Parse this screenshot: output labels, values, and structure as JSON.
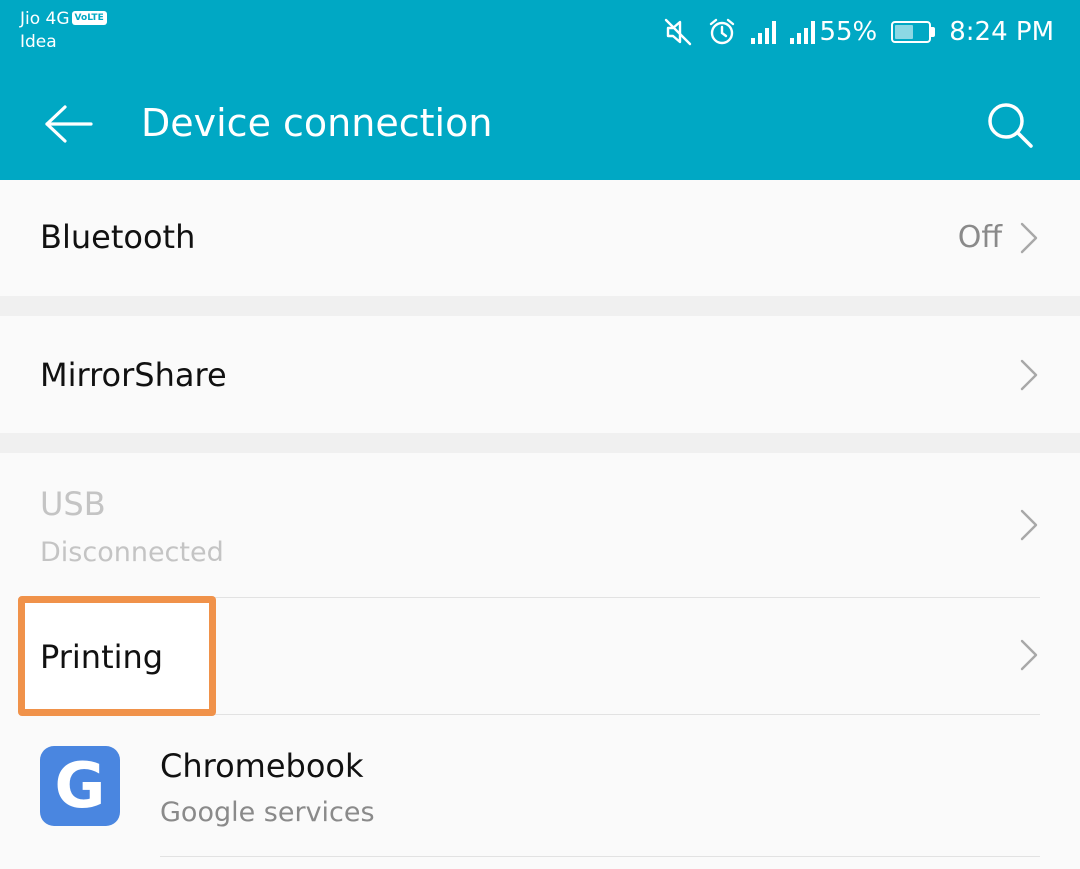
{
  "status_bar": {
    "carrier_1": "Jio 4G",
    "volte_badge": "VoLTE",
    "carrier_2": "Idea",
    "battery_percent": "55%",
    "battery_level": 0.55,
    "time": "8:24 PM"
  },
  "header": {
    "title": "Device connection",
    "background_color": "#00a8c4"
  },
  "items": {
    "bluetooth": {
      "title": "Bluetooth",
      "value": "Off"
    },
    "mirrorshare": {
      "title": "MirrorShare"
    },
    "usb": {
      "title": "USB",
      "subtitle": "Disconnected",
      "disabled": true
    },
    "printing": {
      "title": "Printing",
      "highlighted": true,
      "highlight_color": "#f0924a"
    },
    "chromebook": {
      "title": "Chromebook",
      "subtitle": "Google services",
      "icon_letter": "G",
      "icon_color": "#4a86e0"
    }
  },
  "icons": {
    "back": "arrow-left-icon",
    "search": "search-icon",
    "mute": "mute-icon",
    "alarm": "alarm-icon",
    "signal": "signal-icon",
    "battery": "battery-icon",
    "chevron": "chevron-right-icon"
  }
}
